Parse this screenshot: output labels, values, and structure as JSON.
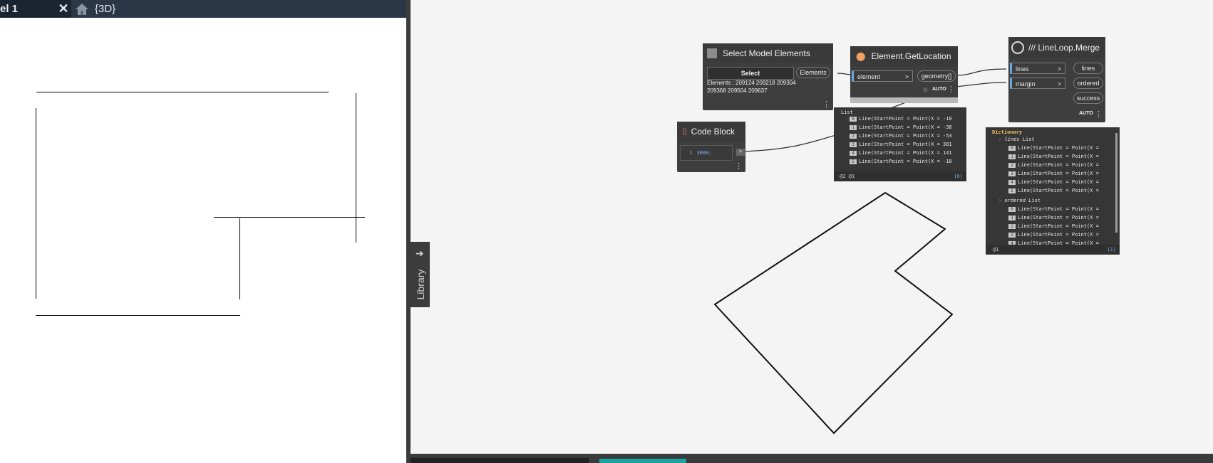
{
  "revit": {
    "tab_active": "el 1",
    "tab_3d": "{3D}"
  },
  "library": {
    "label": "Library"
  },
  "nodes": {
    "select_model_elements": {
      "title": "Select Model Elements",
      "button": "Select",
      "output": "Elements",
      "elements_line1": "Elements : 209124 209218 209304",
      "elements_line2": "209368 209504 209637"
    },
    "code_block": {
      "title": "Code Block",
      "line_no": "1",
      "code": "3000;",
      "out": ">"
    },
    "element_get_location": {
      "title": "Element.GetLocation",
      "input": "element",
      "output": "geometry[]",
      "lacing": "AUTO"
    },
    "lineloop_merge": {
      "title": "/// LineLoop.Merge",
      "inputs": [
        "lines",
        "margin"
      ],
      "outputs": [
        "lines",
        "ordered",
        "success"
      ],
      "lacing": "AUTO"
    }
  },
  "preview_list": {
    "header": "List",
    "rows": [
      {
        "idx": "0",
        "text": "Line(StartPoint = Point(X = -18"
      },
      {
        "idx": "1",
        "text": "Line(StartPoint = Point(X = -38"
      },
      {
        "idx": "2",
        "text": "Line(StartPoint = Point(X = -53"
      },
      {
        "idx": "3",
        "text": "Line(StartPoint = Point(X = 381"
      },
      {
        "idx": "4",
        "text": "Line(StartPoint = Point(X = 141"
      },
      {
        "idx": "5",
        "text": "Line(StartPoint = Point(X = -18"
      }
    ],
    "footer_left": "@2 @1",
    "footer_right": "{6}"
  },
  "preview_dict": {
    "header": "Dictionary",
    "key1": "lines",
    "key1_type": "List",
    "lines_rows": [
      {
        "idx": "0",
        "text": "Line(StartPoint = Point(X = "
      },
      {
        "idx": "1",
        "text": "Line(StartPoint = Point(X = "
      },
      {
        "idx": "2",
        "text": "Line(StartPoint = Point(X = "
      },
      {
        "idx": "3",
        "text": "Line(StartPoint = Point(X = "
      },
      {
        "idx": "4",
        "text": "Line(StartPoint = Point(X = "
      },
      {
        "idx": "5",
        "text": "Line(StartPoint = Point(X = "
      }
    ],
    "key2": "ordered",
    "key2_type": "List",
    "ordered_rows": [
      {
        "idx": "0",
        "text": "Line(StartPoint = Point(X = "
      },
      {
        "idx": "1",
        "text": "Line(StartPoint = Point(X = "
      },
      {
        "idx": "2",
        "text": "Line(StartPoint = Point(X = "
      },
      {
        "idx": "3",
        "text": "Line(StartPoint = Point(X = "
      },
      {
        "idx": "4",
        "text": "Line(StartPoint = Point(X = "
      }
    ],
    "footer_left": "@1",
    "footer_right": "{1}"
  },
  "colors": {
    "tab_bar": "#2b3747",
    "canvas": "#f4f4f4",
    "node": "#3e3e3e",
    "accent": "#1ca3a3"
  }
}
